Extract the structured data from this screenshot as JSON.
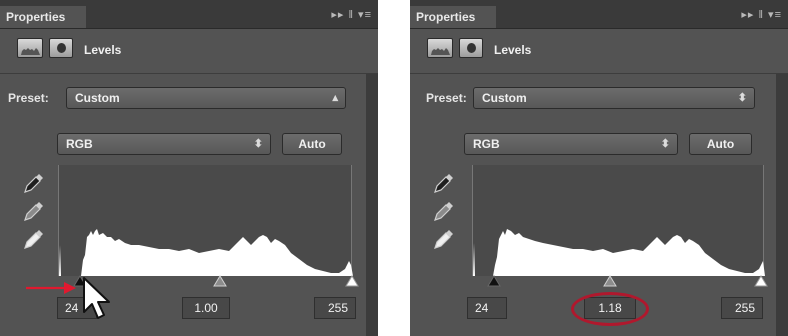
{
  "panels": [
    {
      "tab_label": "Properties",
      "tab_controls": "▸▸ ‖ ▾≡",
      "adjustment_title": "Levels",
      "preset_label": "Preset:",
      "preset_value": "Custom",
      "channel_value": "RGB",
      "auto_label": "Auto",
      "input_black": "24",
      "input_gamma": "1.00",
      "input_white": "255"
    },
    {
      "tab_label": "Properties",
      "tab_controls": "▸▸ ‖ ▾≡",
      "adjustment_title": "Levels",
      "preset_label": "Preset:",
      "preset_value": "Custom",
      "channel_value": "RGB",
      "auto_label": "Auto",
      "input_black": "24",
      "input_gamma": "1.18",
      "input_white": "255"
    }
  ],
  "icons": {
    "levels": "levels-histogram-icon",
    "mask": "mask-icon",
    "select_arrows": "updown-arrows-icon",
    "eyedropper": "eyedropper-icon",
    "cursor": "mouse-pointer-icon"
  },
  "colors": {
    "panel": "#535353",
    "tabbar": "#3a3a3a",
    "annotation_red": "#b0182d",
    "arrow_red": "#e0192f"
  }
}
